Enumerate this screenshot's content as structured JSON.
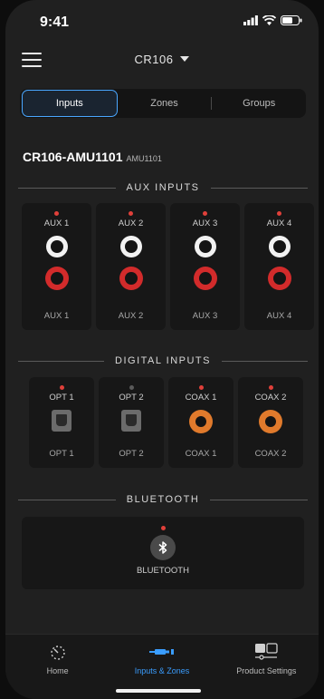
{
  "status": {
    "time": "9:41"
  },
  "header": {
    "device": "CR106"
  },
  "tabs": [
    {
      "label": "Inputs",
      "active": true
    },
    {
      "label": "Zones",
      "active": false
    },
    {
      "label": "Groups",
      "active": false
    }
  ],
  "amp": {
    "name": "CR106-AMU1101",
    "model": "AMU1101"
  },
  "aux": {
    "title": "AUX INPUTS",
    "items": [
      {
        "top": "AUX 1",
        "bottom": "AUX 1",
        "led": "#e0403a"
      },
      {
        "top": "AUX 2",
        "bottom": "AUX 2",
        "led": "#e0403a"
      },
      {
        "top": "AUX 3",
        "bottom": "AUX 3",
        "led": "#e0403a"
      },
      {
        "top": "AUX 4",
        "bottom": "AUX 4",
        "led": "#e0403a"
      }
    ]
  },
  "digital": {
    "title": "DIGITAL INPUTS",
    "items": [
      {
        "top": "OPT 1",
        "bottom": "OPT 1",
        "type": "optical",
        "led": "#e0403a"
      },
      {
        "top": "OPT 2",
        "bottom": "OPT 2",
        "type": "optical",
        "led": "#5a5a5a"
      },
      {
        "top": "COAX 1",
        "bottom": "COAX 1",
        "type": "coax",
        "led": "#e0403a"
      },
      {
        "top": "COAX 2",
        "bottom": "COAX 2",
        "type": "coax",
        "led": "#e0403a"
      }
    ]
  },
  "bluetooth": {
    "title": "BLUETOOTH",
    "label": "BLUETOOTH",
    "led": "#e0403a"
  },
  "nav": [
    {
      "label": "Home",
      "icon": "home-dial-icon",
      "active": false
    },
    {
      "label": "Inputs & Zones",
      "icon": "cable-plug-icon",
      "active": true
    },
    {
      "label": "Product Settings",
      "icon": "product-settings-icon",
      "active": false
    }
  ],
  "colors": {
    "accent": "#3a9dff",
    "led_on": "#e0403a",
    "rca_red": "#d22b2b",
    "coax": "#e07a2c"
  }
}
